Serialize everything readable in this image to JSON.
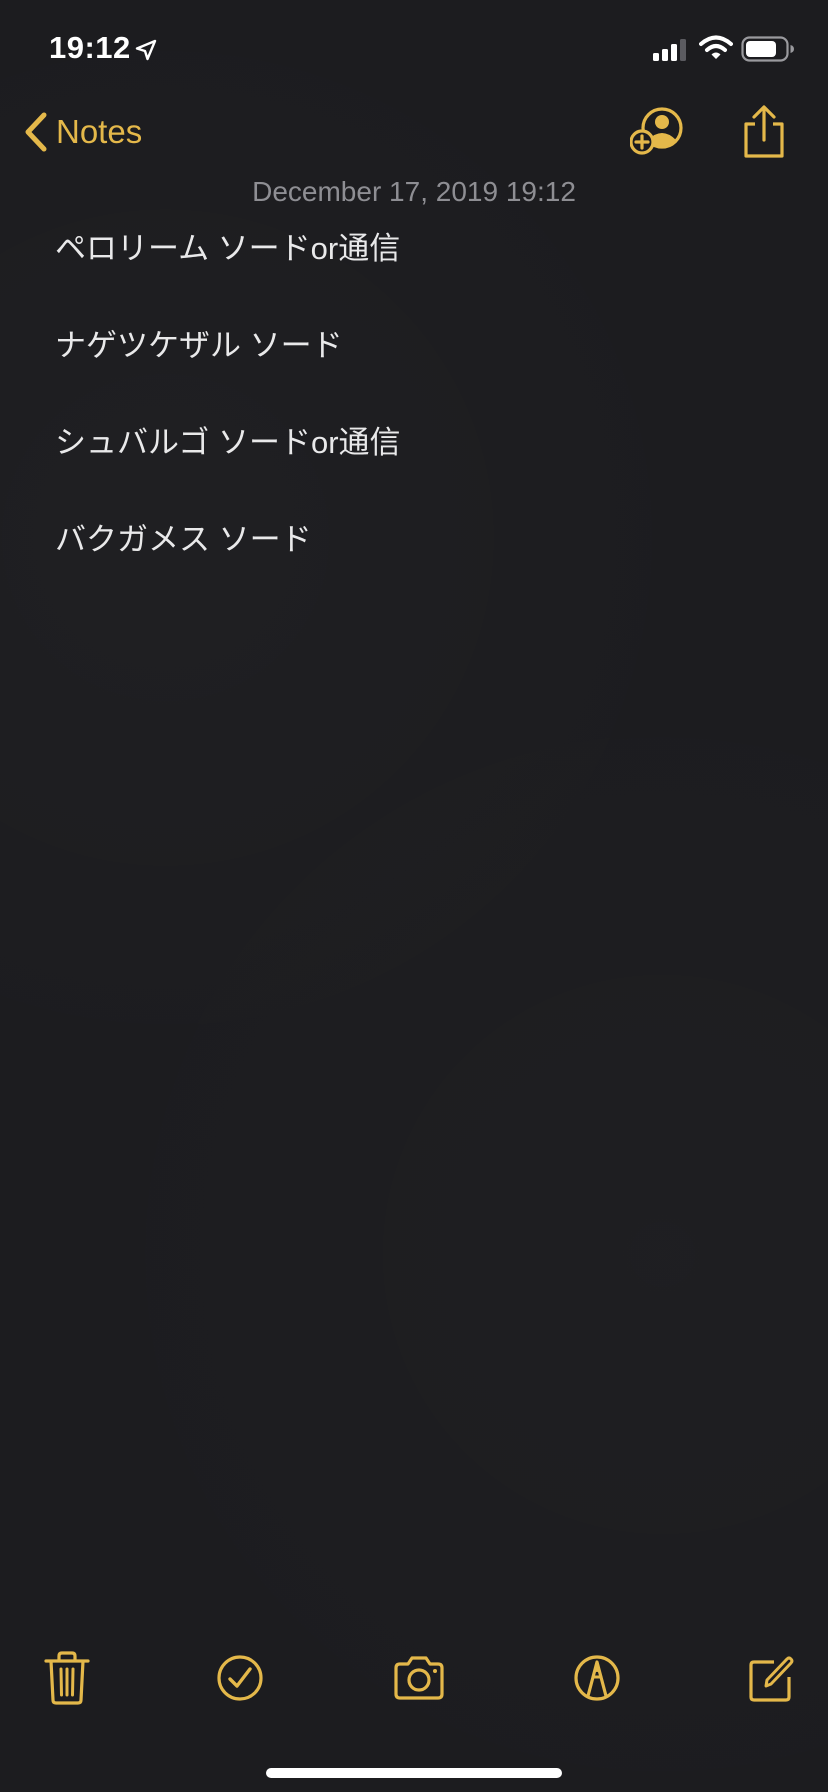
{
  "status_bar": {
    "time": "19:12"
  },
  "nav": {
    "back_label": "Notes"
  },
  "note": {
    "date": "December 17, 2019 19:12",
    "lines": [
      "ペロリーム ソードor通信",
      "ナゲツケザル ソード",
      "シュバルゴ ソードor通信",
      "バクガメス ソード"
    ]
  },
  "icons": {
    "location": "location-arrow-icon",
    "signal": "cellular-signal-icon",
    "wifi": "wifi-icon",
    "battery": "battery-icon",
    "back": "chevron-left-icon",
    "add_person": "add-person-icon",
    "share": "share-icon",
    "trash": "trash-icon",
    "checklist": "checkmark-circle-icon",
    "camera": "camera-icon",
    "markup": "markup-pen-icon",
    "compose": "compose-icon"
  },
  "colors": {
    "accent": "#e4b84a",
    "background": "#1c1c1f",
    "text": "#e9e9ea",
    "secondary_text": "#8e8e93"
  }
}
